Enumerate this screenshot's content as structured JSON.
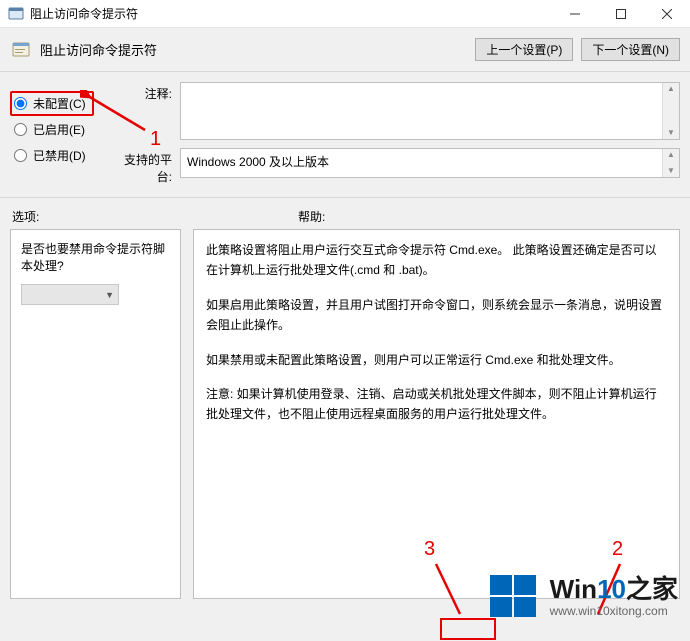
{
  "window": {
    "title": "阻止访问命令提示符"
  },
  "header": {
    "title": "阻止访问命令提示符",
    "prev_btn": "上一个设置(P)",
    "next_btn": "下一个设置(N)"
  },
  "state": {
    "not_configured": "未配置(C)",
    "enabled": "已启用(E)",
    "disabled": "已禁用(D)",
    "selected": "not_configured"
  },
  "fields": {
    "comment_label": "注释:",
    "comment_value": "",
    "platform_label": "支持的平台:",
    "platform_value": "Windows 2000 及以上版本"
  },
  "options": {
    "section_label": "选项:",
    "question": "是否也要禁用命令提示符脚本处理?",
    "combo_value": ""
  },
  "help": {
    "section_label": "帮助:",
    "paragraphs": [
      "此策略设置将阻止用户运行交互式命令提示符 Cmd.exe。  此策略设置还确定是否可以在计算机上运行批处理文件(.cmd 和 .bat)。",
      "如果启用此策略设置，并且用户试图打开命令窗口，则系统会显示一条消息，说明设置会阻止此操作。",
      "如果禁用或未配置此策略设置，则用户可以正常运行 Cmd.exe 和批处理文件。",
      "注意: 如果计算机使用登录、注销、启动或关机批处理文件脚本，则不阻止计算机运行批处理文件，也不阻止使用远程桌面服务的用户运行批处理文件。"
    ]
  },
  "annotations": {
    "n1": "1",
    "n2": "2",
    "n3": "3"
  },
  "watermark": {
    "brand_a": "Win",
    "brand_b": "10",
    "brand_c": "之家",
    "url": "www.win10xitong.com"
  }
}
